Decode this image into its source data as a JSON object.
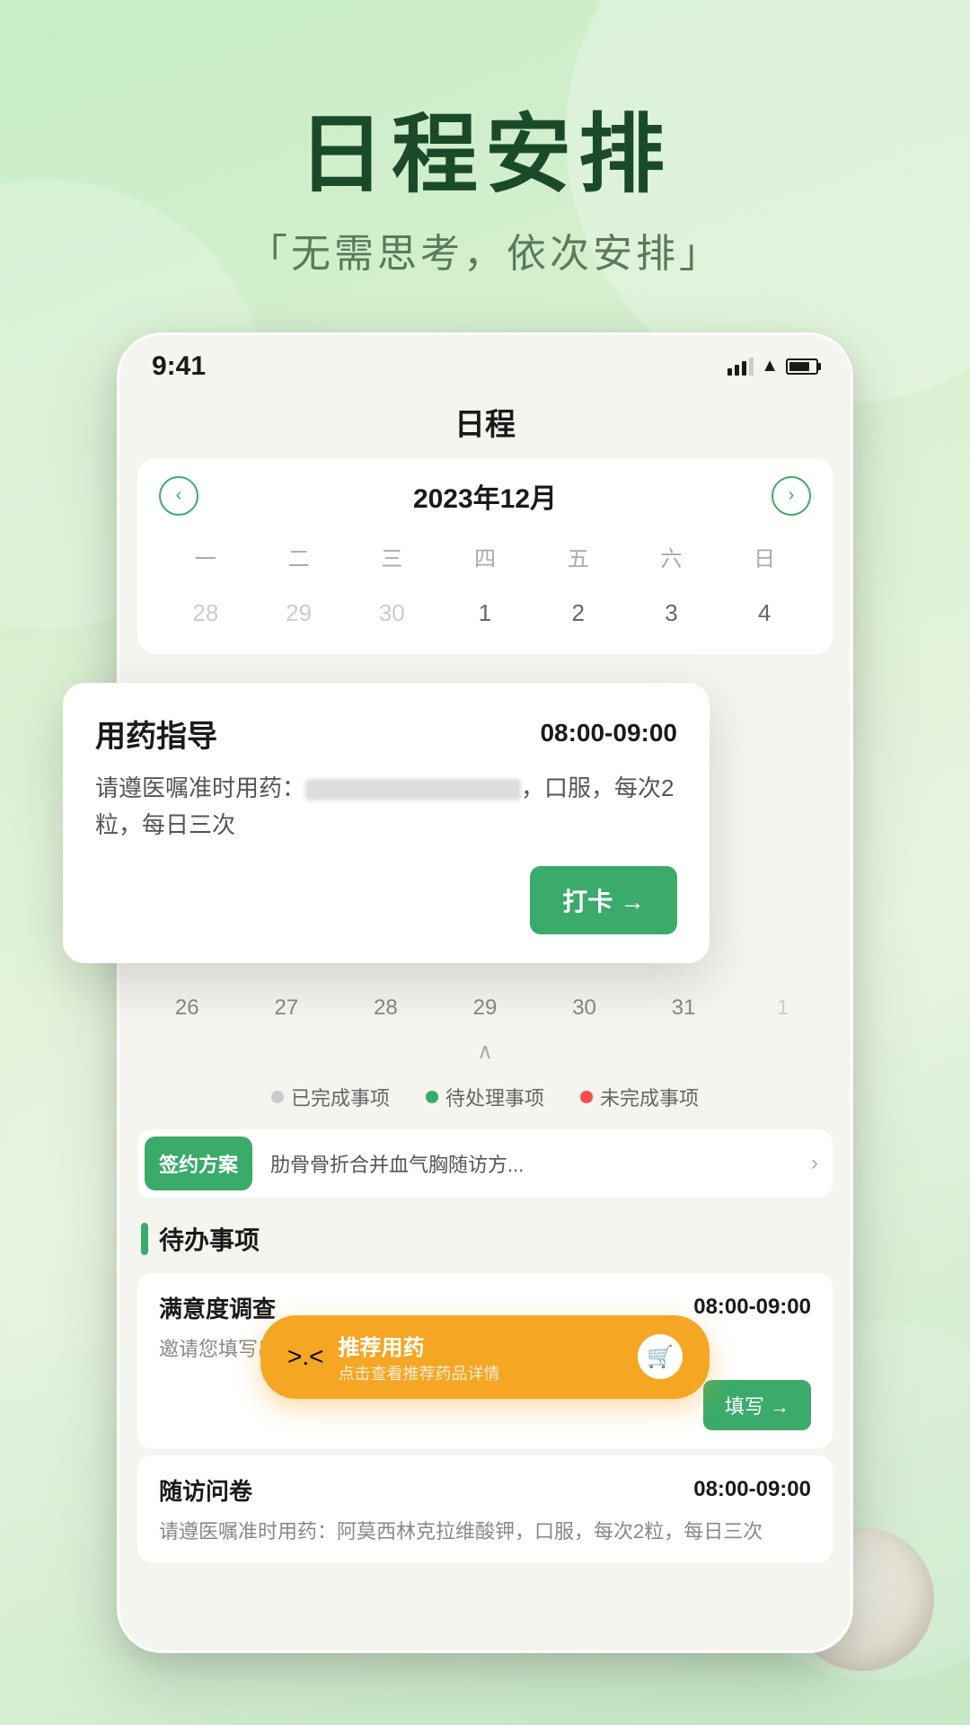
{
  "hero": {
    "title": "日程安排",
    "subtitle": "「无需思考，依次安排」"
  },
  "status_bar": {
    "time": "9:41",
    "signal_level": 3,
    "battery_percent": 80
  },
  "app": {
    "title": "日程"
  },
  "calendar": {
    "month_label": "2023年12月",
    "prev_btn": "‹",
    "next_btn": "›",
    "weekdays": [
      "一",
      "二",
      "三",
      "四",
      "五",
      "六",
      "日"
    ],
    "first_row": [
      "28",
      "29",
      "30",
      "1",
      "2",
      "3",
      "4"
    ],
    "second_row": [
      "26",
      "27",
      "28",
      "29",
      "30",
      "31",
      "1"
    ]
  },
  "medication_card": {
    "title": "用药指导",
    "time": "08:00-09:00",
    "desc_prefix": "请遵医嘱准时用药：",
    "desc_suffix": "，口服，每次2粒，每日三次",
    "checkin_btn": "打卡 →"
  },
  "legend": {
    "completed": "已完成事项",
    "pending": "待处理事项",
    "incomplete": "未完成事项"
  },
  "plan_row": {
    "tag": "签约方案",
    "text": "肋骨骨折合并血气胸随访方...",
    "arrow": "›"
  },
  "todo_section": {
    "label": "待办事项",
    "items": [
      {
        "title": "满意度调查",
        "time": "08:00-09:00",
        "desc": "邀请您填写出院满意度调查",
        "btn": "填写 →"
      },
      {
        "title": "随访问卷",
        "time": "08:00-09:00",
        "desc": "请遵医嘱准时用药：阿莫西林克拉维酸钾，口服，每次2粒，每日三次"
      }
    ]
  },
  "recommend": {
    "icon": ">.<",
    "title": "推荐用药",
    "subtitle": "点击查看推荐药品详情"
  }
}
